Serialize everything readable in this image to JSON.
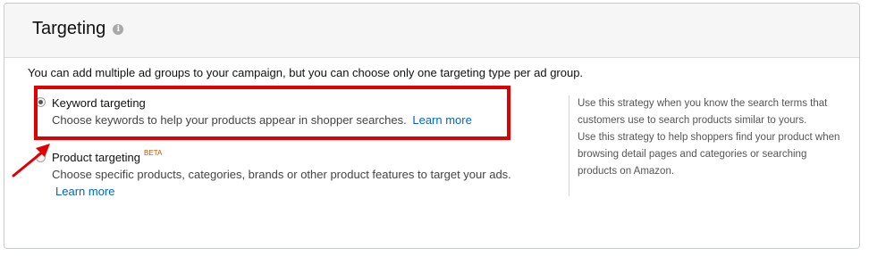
{
  "panel": {
    "title": "Targeting",
    "info_icon": "info-icon",
    "intro": "You can add multiple ad groups to your campaign, but you can choose only one targeting type per ad group."
  },
  "options": {
    "keyword": {
      "label": "Keyword targeting",
      "description": "Choose keywords to help your products appear in shopper searches.",
      "learn_more": "Learn more",
      "selected": true
    },
    "product": {
      "label": "Product targeting",
      "badge": "BETA",
      "description": "Choose specific products, categories, brands or other product features to target your ads.",
      "learn_more": "Learn more",
      "selected": false
    }
  },
  "help": {
    "keyword_text": "Use this strategy when you know the search terms that customers use to search products similar to yours.",
    "product_text": "Use this strategy to help shoppers find your product when browsing detail pages and categories or searching products on Amazon."
  },
  "colors": {
    "highlight": "#e00000",
    "link": "#0066c0",
    "beta": "#c45500"
  }
}
